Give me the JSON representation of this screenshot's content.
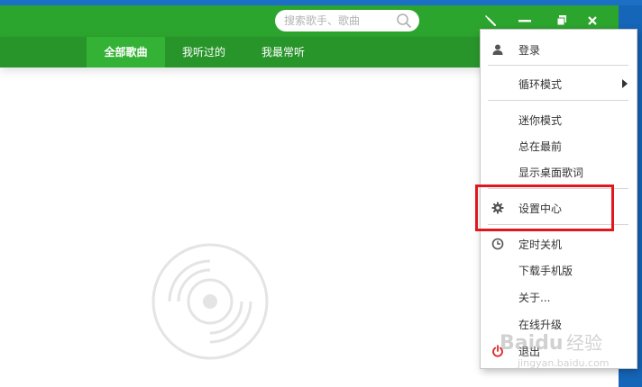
{
  "search": {
    "placeholder": "搜索歌手、歌曲"
  },
  "window_controls": [
    "wrench-icon",
    "minimize-icon",
    "restore-icon",
    "close-icon"
  ],
  "tabs": [
    {
      "label": "全部歌曲",
      "active": true
    },
    {
      "label": "我听过的",
      "active": false
    },
    {
      "label": "我最常听",
      "active": false
    }
  ],
  "menu": {
    "items": [
      {
        "label": "登录",
        "icon": "user-icon"
      },
      {
        "label": "循环模式",
        "submenu": true
      },
      {
        "label": "迷你模式"
      },
      {
        "label": "总在最前"
      },
      {
        "label": "显示桌面歌词"
      },
      {
        "label": "设置中心",
        "icon": "gear-icon",
        "highlighted": true
      },
      {
        "label": "定时关机",
        "icon": "clock-icon"
      },
      {
        "label": "下载手机版"
      },
      {
        "label": "关于..."
      },
      {
        "label": "在线升级"
      },
      {
        "label": "退出",
        "icon": "power-icon"
      }
    ]
  },
  "watermark": {
    "brand": "Baidu",
    "suffix": "经验",
    "url": "jingyan.baidu.com"
  },
  "colors": {
    "titlebar": "#2ca52e",
    "tabbar": "#28952a",
    "active_tab": "#33b235",
    "highlight": "#e0181e",
    "desktop": "#1565b8"
  }
}
